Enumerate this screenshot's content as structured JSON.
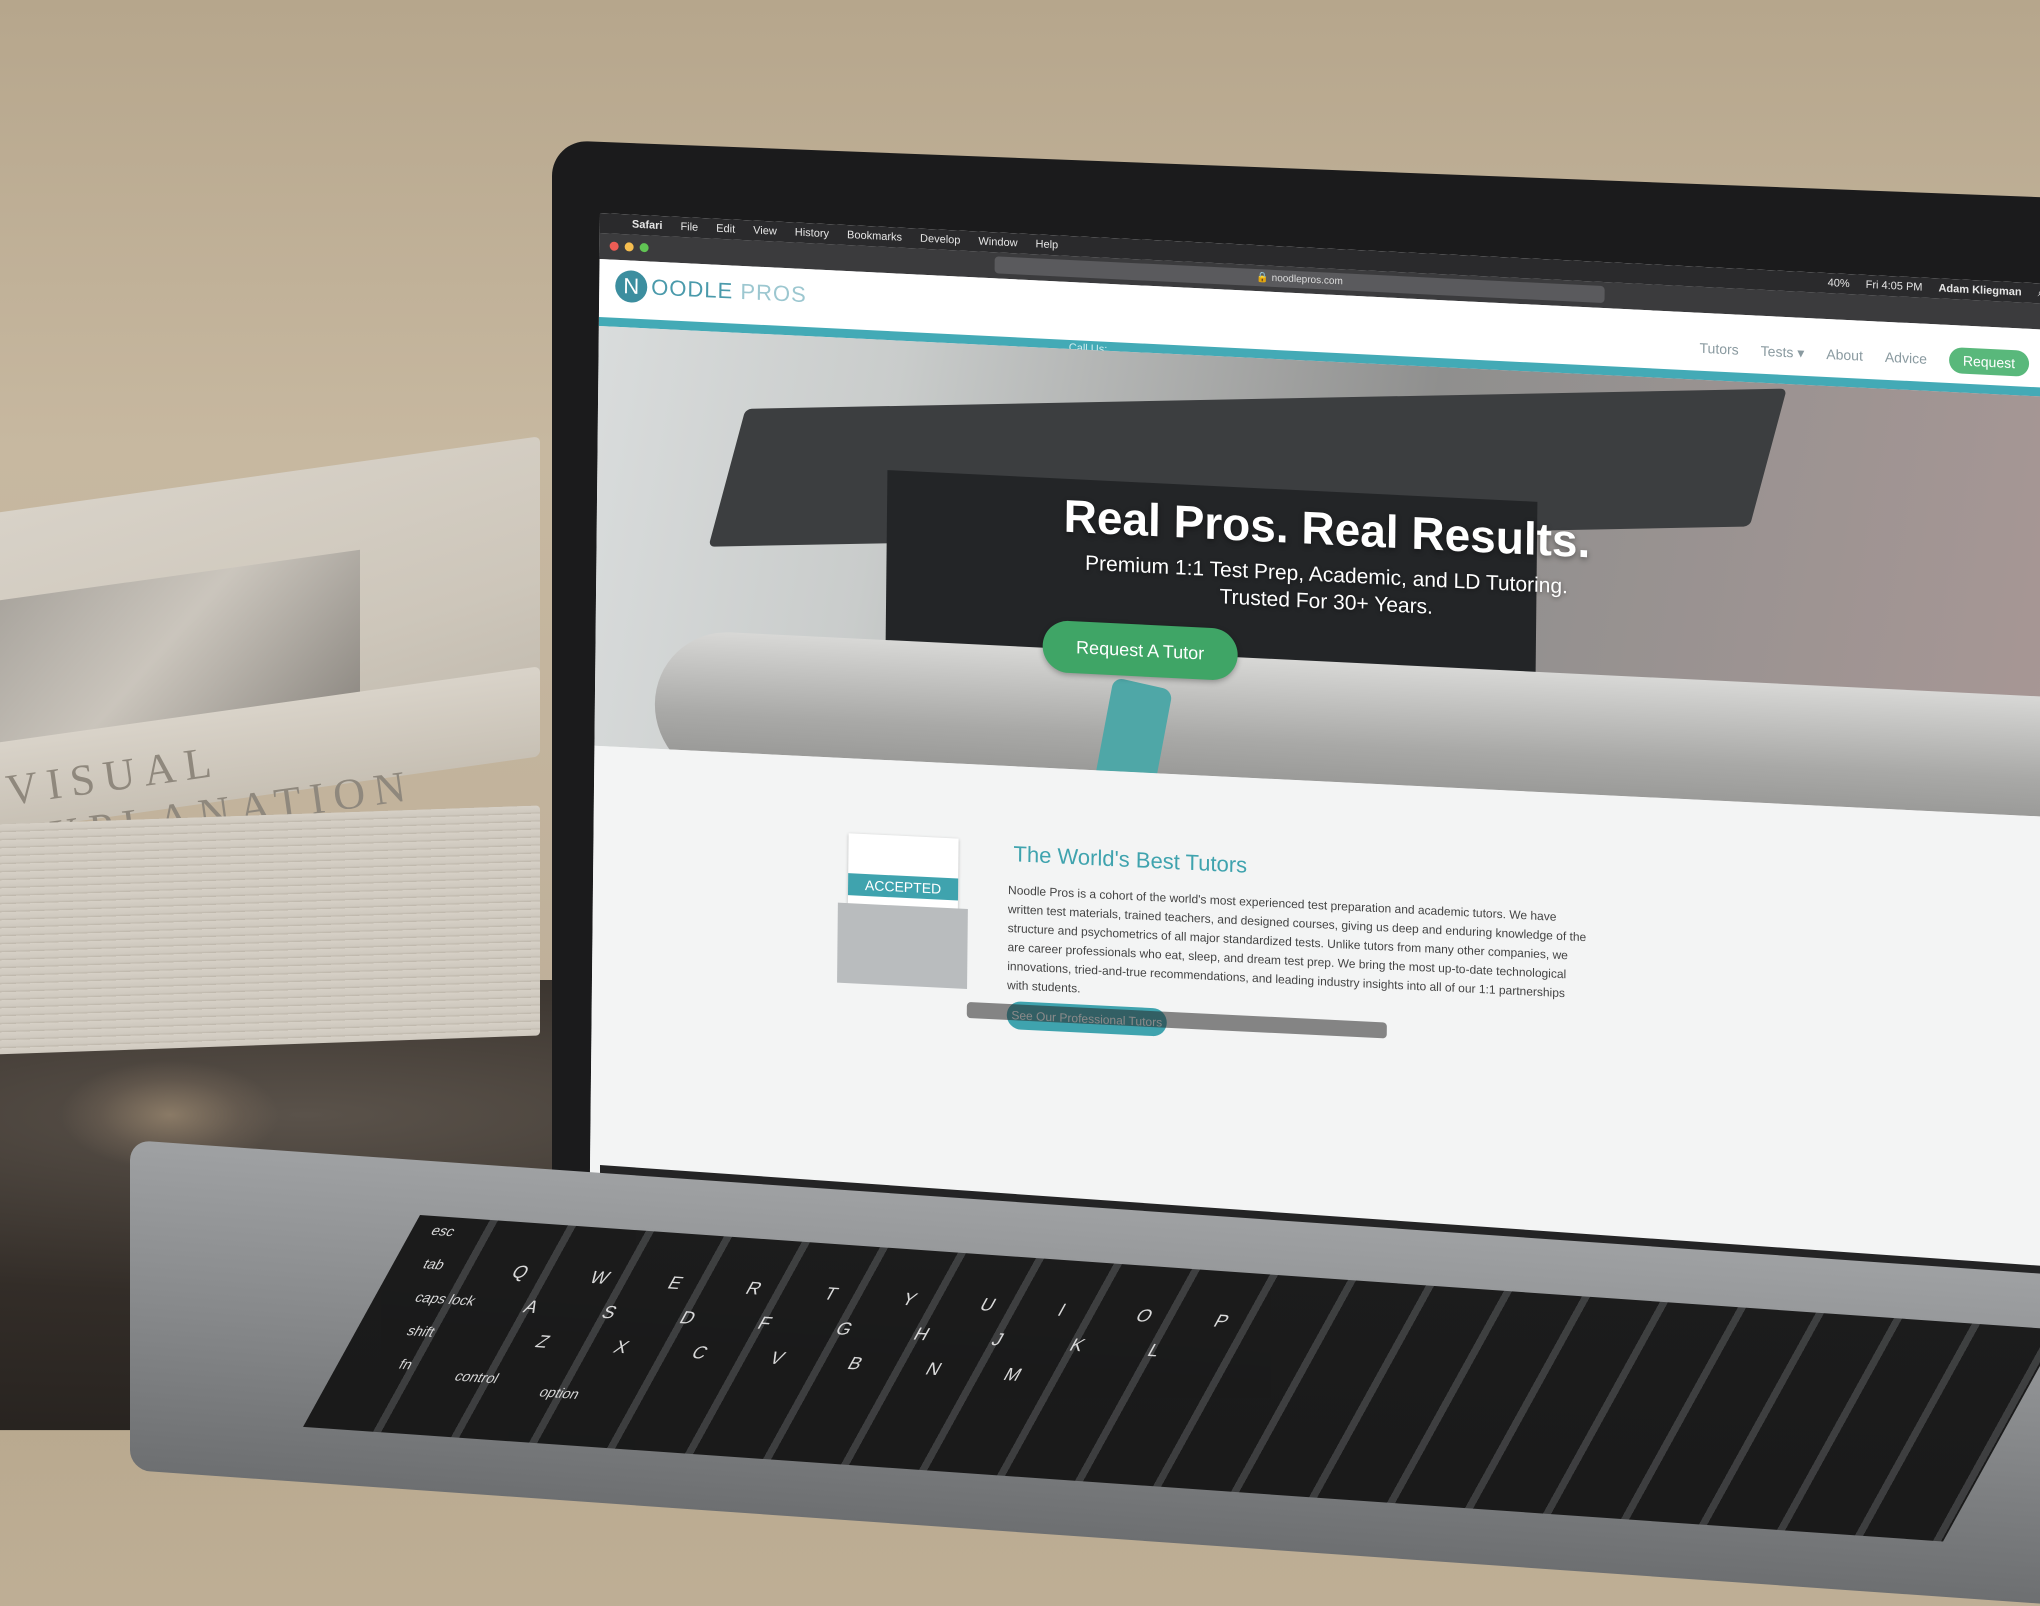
{
  "book": {
    "spine_text": "VISUAL EXPLANATION"
  },
  "menubar": {
    "apple": "",
    "app": "Safari",
    "items": [
      "File",
      "Edit",
      "View",
      "History",
      "Bookmarks",
      "Develop",
      "Window",
      "Help"
    ],
    "battery": "40%",
    "clock": "Fri 4:05 PM",
    "user": "Adam Kliegman"
  },
  "browser": {
    "url": "noodlepros.com"
  },
  "site": {
    "logo_letter": "N",
    "logo_main": "OODLE",
    "logo_accent": "PROS",
    "nav": [
      "Tutors",
      "Tests ▾",
      "About",
      "Advice"
    ],
    "nav_cta": "Request",
    "callus": "Call Us:"
  },
  "hero": {
    "title": "Real Pros. Real Results.",
    "subtitle_line1": "Premium 1:1 Test Prep, Academic, and LD Tutoring.",
    "subtitle_line2": "Trusted For 30+ Years.",
    "cta": "Request A Tutor"
  },
  "section": {
    "badge": "ACCEPTED",
    "title": "The World's Best Tutors",
    "body": "Noodle Pros is a cohort of the world's most experienced test preparation and academic tutors. We have written test materials, trained teachers, and designed courses, giving us deep and enduring knowledge of the structure and psychometrics of all major standardized tests. Unlike tutors from many other companies, we are career professionals who eat, sleep, and dream test prep. We bring the most up-to-date technological innovations, tried-and-true recommendations, and leading industry insights into all of our 1:1 partnerships with students.",
    "cta": "See Our Professional Tutors"
  },
  "keyboard": {
    "keys": [
      "esc",
      "tab",
      "caps lock",
      "shift",
      "fn",
      "control",
      "option",
      "Q",
      "W",
      "E",
      "R",
      "T",
      "Y",
      "U",
      "I",
      "O",
      "P",
      "A",
      "S",
      "D",
      "F",
      "G",
      "H",
      "J",
      "K",
      "L",
      "Z",
      "X",
      "C",
      "V",
      "B",
      "N",
      "M"
    ]
  }
}
